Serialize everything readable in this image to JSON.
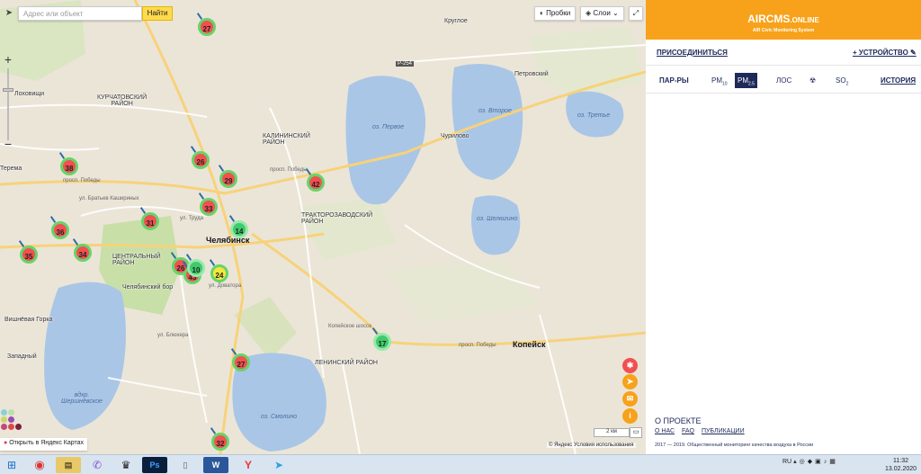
{
  "map": {
    "search_placeholder": "Адрес или объект",
    "find_label": "Найти",
    "traffic_label": "Пробки",
    "layers_label": "Слои",
    "zoom_in": "+",
    "zoom_out": "−",
    "open_link": "Открыть в Яндекс Картах",
    "copyright": "© Яндекс  Условия использования",
    "scale": "2 км",
    "markers": [
      {
        "value": "27",
        "tone": "red"
      },
      {
        "value": "38",
        "tone": "red"
      },
      {
        "value": "26",
        "tone": "red"
      },
      {
        "value": "29",
        "tone": "red"
      },
      {
        "value": "42",
        "tone": "red"
      },
      {
        "value": "33",
        "tone": "red"
      },
      {
        "value": "31",
        "tone": "red"
      },
      {
        "value": "14",
        "tone": "green"
      },
      {
        "value": "36",
        "tone": "red"
      },
      {
        "value": "34",
        "tone": "red"
      },
      {
        "value": "35",
        "tone": "red"
      },
      {
        "value": "26",
        "tone": "red"
      },
      {
        "value": "43",
        "tone": "red"
      },
      {
        "value": "10",
        "tone": "green"
      },
      {
        "value": "24",
        "tone": "yellow"
      },
      {
        "value": "17",
        "tone": "green"
      },
      {
        "value": "27",
        "tone": "red"
      },
      {
        "value": "32",
        "tone": "red"
      }
    ],
    "labels": {
      "kurchatovsky": "КУРЧАТОВСКИЙ\nРАЙОН",
      "kalininsky": "КАЛИНИНСКИЙ\nРАЙОН",
      "chelyabinsk": "Челябинск",
      "traktorozavodsky": "ТРАКТОРОЗАВОДСКИЙ\nРАЙОН",
      "central": "ЦЕНТРАЛЬНЫЙ\nРАЙОН",
      "leninsky": "ЛЕНИНСКИЙ РАЙОН",
      "kopeisk": "Копейск",
      "pervoe": "оз. Первое",
      "vtoroe": "оз. Второе",
      "trete": "оз. Третье",
      "shelyugino": "оз. Шелюгино",
      "smolino": "оз. Смолино",
      "shershni": "вдхр.\nШершнёвское",
      "petrovsky": "Петровский",
      "kruglove": "Круглое",
      "churilovo": "Чурилово",
      "terema": "Терема",
      "tokovishchi": "Лоховищи",
      "vishnevaya": "Вишнёвая Горка",
      "zapadny": "Западный",
      "bor": "Челябинский бор",
      "pobedy": "просп. Победы",
      "pobedy2": "просп. Победы",
      "kashirinyh": "ул. Братьев Кашириных",
      "truda": "ул. Труда",
      "pobedy3": "просп. Победы",
      "dovatora": "ул. Доватора",
      "blyukhera": "ул. Блюхера",
      "kopeiskoe": "Копейское шоссе",
      "p254": "Р-254"
    }
  },
  "panel": {
    "brand_main": "AIRCMS",
    "brand_suffix": ".ONLINE",
    "tagline": "AIR Civic Monitoring System",
    "join": "ПРИСОЕДИНИТЬСЯ",
    "device": "+ УСТРОЙСТВО",
    "params_label": "ПАР-РЫ",
    "tabs": {
      "pm10": "PM",
      "pm10_sub": "10",
      "pm25": "PM",
      "pm25_sub": "2.5",
      "los": "ЛОС",
      "so2": "SO",
      "so2_sub": "2"
    },
    "history": "ИСТОРИЯ",
    "about_title": "О ПРОЕКТЕ",
    "about_links": [
      "О НАС",
      "FAQ",
      "ПУБЛИКАЦИИ"
    ],
    "footer": "2017 — 2019. Общественный мониторинг качества воздуха в России",
    "colors": {
      "accent": "#f7a21a",
      "navy": "#1e2a5a"
    }
  },
  "taskbar": {
    "lang": "RU",
    "time": "11:32",
    "date": "13.02.2020"
  }
}
